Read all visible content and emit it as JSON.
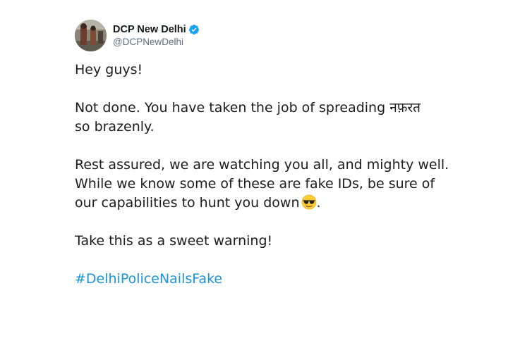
{
  "tweet": {
    "display_name": "DCP New Delhi",
    "handle": "@DCPNewDelhi",
    "verified": true,
    "lines": {
      "greeting": "Hey guys!",
      "p2_line1": "Not done. You have taken the job of spreading नफ़रत",
      "p2_line2": "so brazenly.",
      "p3_line1": "Rest assured, we are watching you all, and mighty well.",
      "p3_line2": "While we know some of these are fake IDs, be sure of",
      "p3_line3": "our capabilities to hunt you down",
      "p3_line3_after_emoji": ".",
      "p4_line1": "Take this as a sweet warning!"
    },
    "emoji": "smiling-face-with-sunglasses",
    "hashtag": "#DelhiPoliceNailsFake"
  },
  "colors": {
    "hashtag": "#1b95e0",
    "verified_badge": "#1da1f2",
    "handle": "#5b7083",
    "text": "#1c1c1c"
  }
}
